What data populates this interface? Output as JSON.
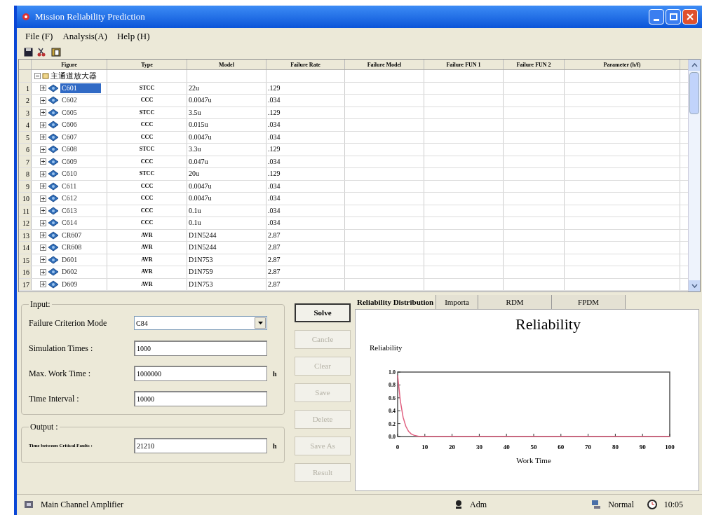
{
  "window": {
    "title": "Mission Reliability Prediction"
  },
  "menu": [
    {
      "label": "File (F)"
    },
    {
      "label": "Analysis(A)"
    },
    {
      "label": "Help (H)"
    }
  ],
  "grid": {
    "columns": [
      "Figure",
      "Type",
      "Model",
      "Failure Rate",
      "Failure Model",
      "Failure FUN 1",
      "Failure FUN 2",
      "Parameter (h/f)"
    ],
    "root": {
      "label": "主通道放大器",
      "expanded": true
    },
    "rows": [
      {
        "number": "1",
        "name": "C601",
        "type": "STCC",
        "model": "22u",
        "failure_rate": ".129",
        "selected": true
      },
      {
        "number": "2",
        "name": "C602",
        "type": "CCC",
        "model": "0.0047u",
        "failure_rate": ".034",
        "selected": false
      },
      {
        "number": "3",
        "name": "C605",
        "type": "STCC",
        "model": "3.5u",
        "failure_rate": ".129",
        "selected": false
      },
      {
        "number": "4",
        "name": "C606",
        "type": "CCC",
        "model": "0.015u",
        "failure_rate": ".034",
        "selected": false
      },
      {
        "number": "5",
        "name": "C607",
        "type": "CCC",
        "model": "0.0047u",
        "failure_rate": ".034",
        "selected": false
      },
      {
        "number": "6",
        "name": "C608",
        "type": "STCC",
        "model": "3.3u",
        "failure_rate": ".129",
        "selected": false
      },
      {
        "number": "7",
        "name": "C609",
        "type": "CCC",
        "model": "0.047u",
        "failure_rate": ".034",
        "selected": false
      },
      {
        "number": "8",
        "name": "C610",
        "type": "STCC",
        "model": "20u",
        "failure_rate": ".129",
        "selected": false
      },
      {
        "number": "9",
        "name": "C611",
        "type": "CCC",
        "model": "0.0047u",
        "failure_rate": ".034",
        "selected": false
      },
      {
        "number": "10",
        "name": "C612",
        "type": "CCC",
        "model": "0.0047u",
        "failure_rate": ".034",
        "selected": false
      },
      {
        "number": "11",
        "name": "C613",
        "type": "CCC",
        "model": "0.1u",
        "failure_rate": ".034",
        "selected": false
      },
      {
        "number": "12",
        "name": "C614",
        "type": "CCC",
        "model": "0.1u",
        "failure_rate": ".034",
        "selected": false
      },
      {
        "number": "13",
        "name": "CR607",
        "type": "AVR",
        "model": "D1N5244",
        "failure_rate": "2.87",
        "selected": false
      },
      {
        "number": "14",
        "name": "CR608",
        "type": "AVR",
        "model": "D1N5244",
        "failure_rate": "2.87",
        "selected": false
      },
      {
        "number": "15",
        "name": "D601",
        "type": "AVR",
        "model": "D1N753",
        "failure_rate": "2.87",
        "selected": false
      },
      {
        "number": "16",
        "name": "D602",
        "type": "AVR",
        "model": "D1N759",
        "failure_rate": "2.87",
        "selected": false
      },
      {
        "number": "17",
        "name": "D609",
        "type": "AVR",
        "model": "D1N753",
        "failure_rate": "2.87",
        "selected": false
      }
    ]
  },
  "input": {
    "title": "Input:",
    "fields": [
      {
        "kind": "select",
        "label": "Failure Criterion Mode",
        "value": "C84"
      },
      {
        "kind": "text",
        "label": "Simulation Times :",
        "value": "1000"
      },
      {
        "kind": "text",
        "label": "Max. Work Time :",
        "value": "1000000",
        "unit": "h"
      },
      {
        "kind": "text",
        "label": "Time Interval :",
        "value": "10000"
      }
    ]
  },
  "output": {
    "title": "Output :",
    "fields": [
      {
        "kind": "text",
        "label": "Time between Critical Faults :",
        "value": "21210",
        "unit": "h"
      }
    ]
  },
  "buttons": [
    {
      "label": "Solve",
      "disabled": false
    },
    {
      "label": "Cancle",
      "disabled": true
    },
    {
      "label": "Clear",
      "disabled": true
    },
    {
      "label": "Save",
      "disabled": true
    },
    {
      "label": "Delete",
      "disabled": true
    },
    {
      "label": "Save As",
      "disabled": true
    },
    {
      "label": "Result",
      "disabled": true
    }
  ],
  "tabs": [
    {
      "label": "Reliability Distribution",
      "selected": true
    },
    {
      "label": "Importa",
      "selected": false
    },
    {
      "label": "RDM",
      "selected": false
    },
    {
      "label": "FPDM",
      "selected": false
    }
  ],
  "chart_panel": {
    "title": "Reliability",
    "chart_data": {
      "type": "line",
      "xlabel": "Work Time",
      "ylabel": "Reliability",
      "x": [
        0,
        1,
        2,
        3,
        4,
        5,
        6,
        8,
        10,
        20,
        30,
        40,
        50,
        60,
        70,
        80,
        90,
        100
      ],
      "series": [
        {
          "color": "#e06080",
          "values": [
            0.95,
            0.55,
            0.3,
            0.16,
            0.08,
            0.04,
            0.02,
            0.0,
            0.0,
            0.0,
            0.0,
            0.0,
            0.0,
            0.0,
            0.0,
            0.0,
            0.0,
            0.0
          ]
        }
      ],
      "xlim": [
        0,
        100
      ],
      "ylim": [
        0,
        1
      ],
      "xticks": [
        0,
        10,
        20,
        30,
        40,
        50,
        60,
        70,
        80,
        90,
        100
      ],
      "yticks": [
        {
          "value": 0,
          "label": "0.0"
        },
        {
          "value": 0.2,
          "label": "0.2"
        },
        {
          "value": 0.4,
          "label": "0.4"
        },
        {
          "value": 0.6,
          "label": "0.6"
        },
        {
          "value": 0.8,
          "label": "0.8"
        },
        {
          "value": 1,
          "label": "1.0"
        }
      ]
    }
  },
  "status_bar": [
    {
      "kind": "module",
      "text": "Main Channel Amplifier"
    },
    {
      "kind": "user",
      "text": "Adm"
    },
    {
      "kind": "status",
      "text": "Normal"
    },
    {
      "kind": "clock",
      "text": "10:05"
    }
  ]
}
